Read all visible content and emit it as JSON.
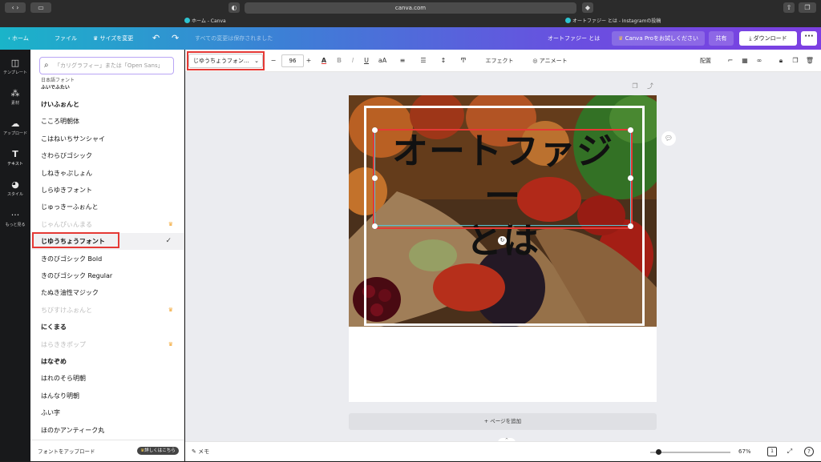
{
  "browser": {
    "url": "canva.com",
    "tabs": [
      {
        "label": "ホーム - Canva"
      },
      {
        "label": "オートファジー とは - Instagramの投稿"
      }
    ]
  },
  "topbar": {
    "home": "ホーム",
    "file": "ファイル",
    "resize": "サイズを変更",
    "save_status": "すべての変更は保存されました",
    "design_title": "オートファジー とは",
    "pro_button": "Canva Proをお試しください",
    "share_button": "共有",
    "download_button": "ダウンロード"
  },
  "rail": [
    {
      "label": "テンプレート",
      "icon": "template-icon"
    },
    {
      "label": "素材",
      "icon": "elements-icon"
    },
    {
      "label": "アップロード",
      "icon": "upload-icon"
    },
    {
      "label": "テキスト",
      "icon": "text-icon"
    },
    {
      "label": "スタイル",
      "icon": "style-icon"
    },
    {
      "label": "もっと見る",
      "icon": "more-icon"
    }
  ],
  "font_panel": {
    "search_placeholder": "「カリグラフィー」または「Open Sans」",
    "section_label": "日本語フォント",
    "fonts": [
      {
        "name": "けいふぉんと",
        "pro": false
      },
      {
        "name": "こころ明朝体",
        "pro": false
      },
      {
        "name": "こはねいちサンシャイ",
        "pro": false
      },
      {
        "name": "さわらびゴシック",
        "pro": false
      },
      {
        "name": "しねきゃぷしょん",
        "pro": false
      },
      {
        "name": "しらゆきフォント",
        "pro": false
      },
      {
        "name": "じゅっきーふぉんと",
        "pro": false
      },
      {
        "name": "じゃんぴぃんまる",
        "pro": true
      },
      {
        "name": "じゆうちょうフォント",
        "pro": false,
        "selected": true
      },
      {
        "name": "きのびゴシック Bold",
        "pro": false
      },
      {
        "name": "きのびゴシック Regular",
        "pro": false
      },
      {
        "name": "たぬき油性マジック",
        "pro": false
      },
      {
        "name": "ちびすけふぉんと",
        "pro": true
      },
      {
        "name": "にくまる",
        "pro": false
      },
      {
        "name": "はらききポップ",
        "pro": true
      },
      {
        "name": "はなぞめ",
        "pro": false
      },
      {
        "name": "はれのそら明朝",
        "pro": false
      },
      {
        "name": "はんなり明朝",
        "pro": false
      },
      {
        "name": "ふい字",
        "pro": false
      },
      {
        "name": "ほのかアンティーク丸",
        "pro": false
      }
    ],
    "upload_font": "フォントをアップロード",
    "details_badge": "詳しくはこちら"
  },
  "toolbar": {
    "font_dropdown": "じゆうちょうフォン...",
    "font_size": "96",
    "effects": "エフェクト",
    "animate": "アニメート",
    "position": "配置"
  },
  "canvas": {
    "headline": "オートファジー とは",
    "add_page": "+ ページを追加"
  },
  "bottombar": {
    "notes": "メモ",
    "zoom": "67%",
    "page_count": "1"
  },
  "colors": {
    "accent_red": "#e53935",
    "selection_teal": "#58c4d6",
    "pro_crown": "#f2a530"
  }
}
